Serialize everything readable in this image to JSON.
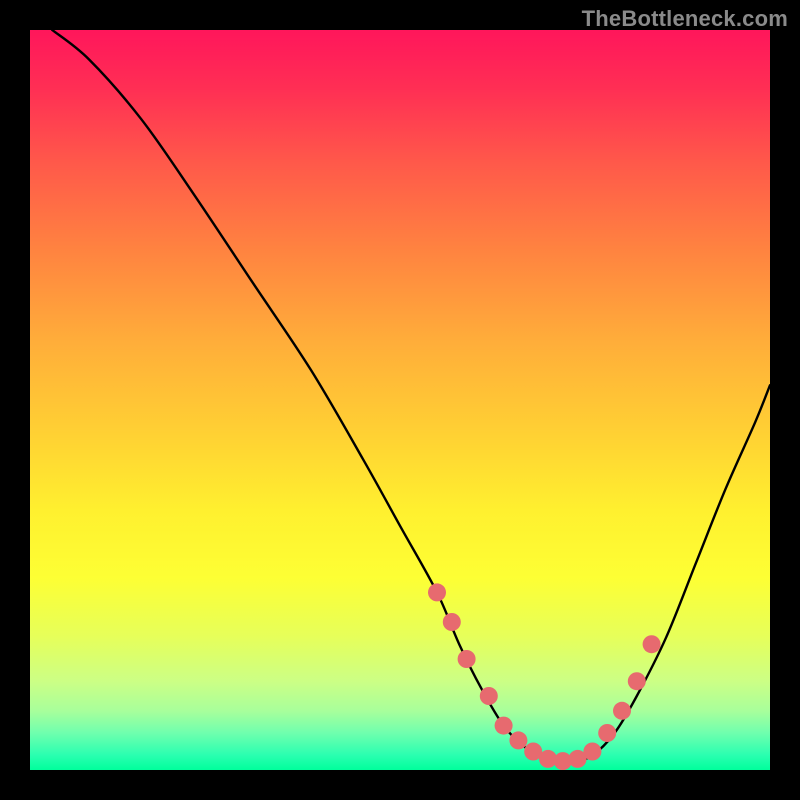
{
  "watermark": "TheBottleneck.com",
  "colors": {
    "background": "#000000",
    "curve": "#000000",
    "dots": "#e76a6f",
    "gradient_top": "#ff165b",
    "gradient_mid": "#fff02f",
    "gradient_bottom": "#00ff9c"
  },
  "chart_data": {
    "type": "line",
    "title": "",
    "xlabel": "",
    "ylabel": "",
    "xlim": [
      0,
      100
    ],
    "ylim": [
      0,
      100
    ],
    "series": [
      {
        "name": "bottleneck-curve",
        "x": [
          3,
          8,
          15,
          22,
          30,
          38,
          45,
          50,
          55,
          58,
          61,
          64,
          67,
          70,
          73,
          76,
          79,
          82,
          86,
          90,
          94,
          98,
          100
        ],
        "values": [
          100,
          96,
          88,
          78,
          66,
          54,
          42,
          33,
          24,
          17,
          11,
          6,
          3,
          1.5,
          1,
          2,
          5,
          10,
          18,
          28,
          38,
          47,
          52
        ]
      }
    ],
    "highlight_points": {
      "name": "near-optimal-dots",
      "x": [
        55,
        57,
        59,
        62,
        64,
        66,
        68,
        70,
        72,
        74,
        76,
        78,
        80,
        82,
        84
      ],
      "values": [
        24,
        20,
        15,
        10,
        6,
        4,
        2.5,
        1.5,
        1.2,
        1.5,
        2.5,
        5,
        8,
        12,
        17
      ]
    }
  }
}
